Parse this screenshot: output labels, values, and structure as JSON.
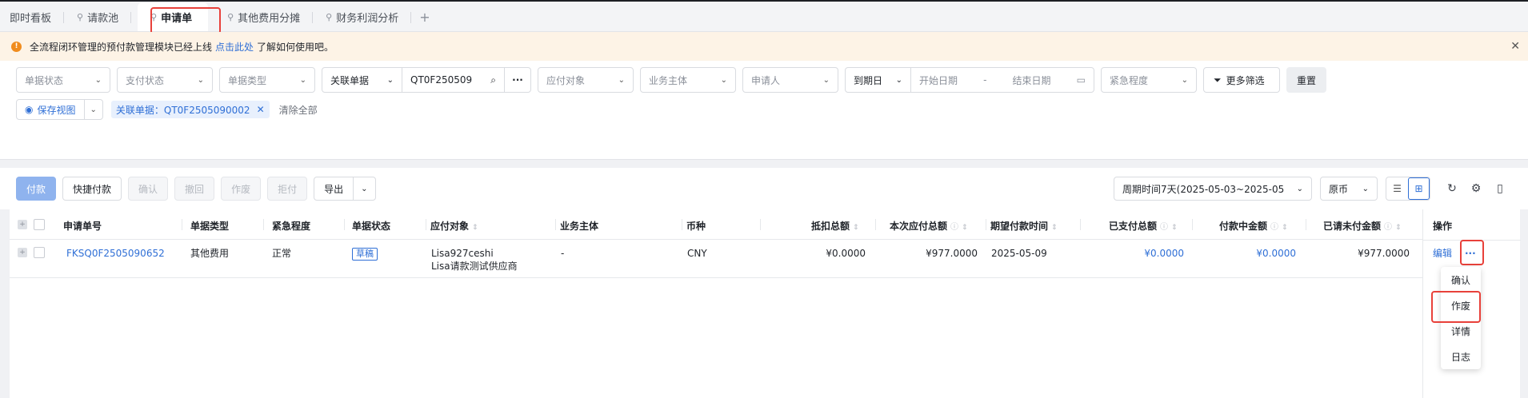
{
  "tabs": [
    {
      "label": "即时看板",
      "pinned": false
    },
    {
      "label": "请款池",
      "pinned": true
    },
    {
      "label": "申请单",
      "pinned": true,
      "active": true
    },
    {
      "label": "其他费用分摊",
      "pinned": true
    },
    {
      "label": "财务利润分析",
      "pinned": true
    }
  ],
  "tab_add": "+",
  "notice": {
    "text": "全流程闭环管理的预付款管理模块已经上线",
    "link": "点击此处",
    "suffix": "了解如何使用吧。"
  },
  "filters": {
    "doc_status": "单据状态",
    "pay_status": "支付状态",
    "doc_type": "单据类型",
    "related_type": "关联单据",
    "related_value": "QT0F250509",
    "payee": "应付对象",
    "entity": "业务主体",
    "applicant": "申请人",
    "date_type": "到期日",
    "start_date": "开始日期",
    "date_sep": "-",
    "end_date": "结束日期",
    "urgency": "紧急程度",
    "more": "更多筛选",
    "reset": "重置",
    "save_view": "保存视图",
    "chip": "关联单据：QT0F2505090002",
    "clear_all": "清除全部"
  },
  "toolbar": {
    "pay": "付款",
    "quick_pay": "快捷付款",
    "confirm": "确认",
    "withdraw": "撤回",
    "void": "作废",
    "reject": "拒付",
    "export": "导出",
    "period": "周期时间7天(2025-05-03~2025-05",
    "currency": "原币"
  },
  "columns": [
    "申请单号",
    "单据类型",
    "紧急程度",
    "单据状态",
    "应付对象",
    "业务主体",
    "币种",
    "抵扣总额",
    "本次应付总额",
    "期望付款时间",
    "已支付总额",
    "付款中金额",
    "已请未付金额",
    "操作"
  ],
  "rows": [
    {
      "id": "FKSQ0F2505090652",
      "type": "其他费用",
      "urgency": "正常",
      "status": "草稿",
      "payee1": "Lisa927ceshi",
      "payee2": "Lisa请款测试供应商",
      "entity": "-",
      "currency": "CNY",
      "deduct": "¥0.0000",
      "payable": "¥977.0000",
      "expected": "2025-05-09",
      "paid": "¥0.0000",
      "paying": "¥0.0000",
      "unpaid": "¥977.0000",
      "edit": "编辑",
      "more": "···"
    }
  ],
  "menu": [
    "确认",
    "作废",
    "详情",
    "日志"
  ]
}
